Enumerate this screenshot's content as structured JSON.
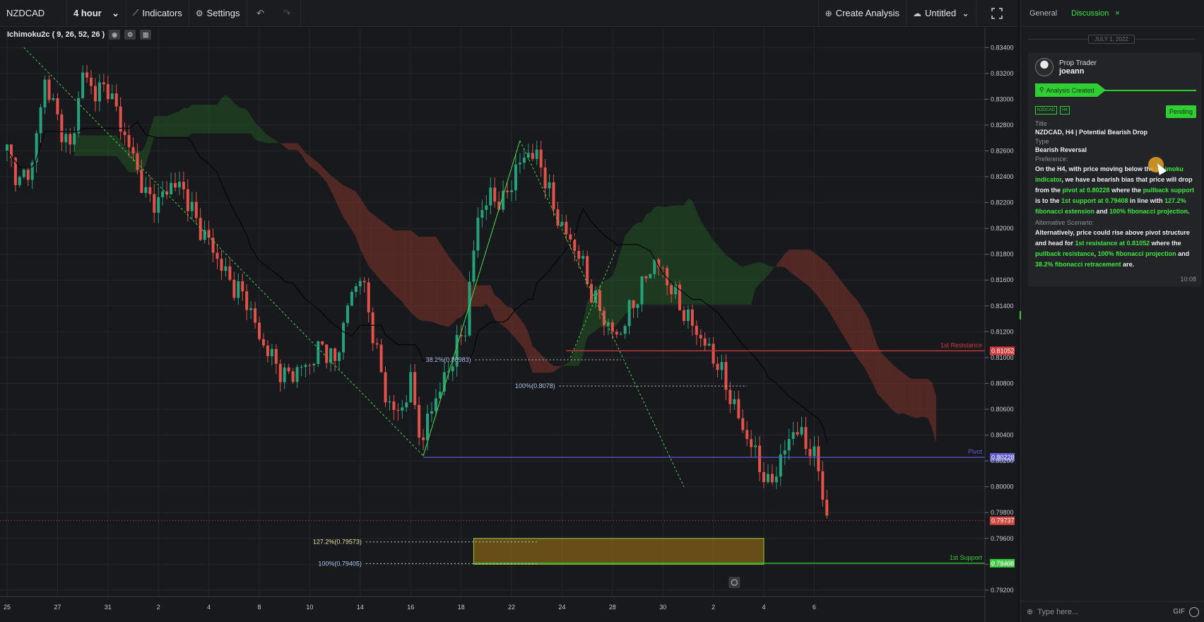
{
  "toolbar": {
    "symbol": "NZDCAD",
    "interval": "4 hour",
    "indicators_label": "Indicators",
    "settings_label": "Settings",
    "undo_icon": "undo-icon",
    "redo_icon": "redo-icon",
    "create_analysis_label": "Create Analysis",
    "layout_name": "Untitled",
    "fullscreen_icon": "fullscreen-icon"
  },
  "indicator_legend": "Ichimoku2c ( 9, 26, 52, 26 )",
  "chart_data": {
    "type": "candlestick",
    "symbol": "NZDCAD",
    "timeframe": "4 hour",
    "y_ticks": [
      "0.83400",
      "0.83200",
      "0.83000",
      "0.82800",
      "0.82600",
      "0.82400",
      "0.82200",
      "0.82000",
      "0.81800",
      "0.81600",
      "0.81400",
      "0.81200",
      "0.81000",
      "0.80800",
      "0.80600",
      "0.80400",
      "0.80200",
      "0.80000",
      "0.79800",
      "0.79600",
      "0.79400",
      "0.79200"
    ],
    "y_tick_values": [
      0.834,
      0.832,
      0.83,
      0.828,
      0.826,
      0.824,
      0.822,
      0.82,
      0.818,
      0.816,
      0.814,
      0.812,
      0.81,
      0.808,
      0.806,
      0.804,
      0.802,
      0.8,
      0.798,
      0.796,
      0.794,
      0.792
    ],
    "x_ticks": [
      "25",
      "27",
      "31",
      "2",
      "4",
      "8",
      "10",
      "14",
      "16",
      "18",
      "22",
      "24",
      "28",
      "30",
      "2",
      "4",
      "6"
    ],
    "x_tick_bars": [
      0,
      12,
      24,
      36,
      48,
      60,
      72,
      84,
      96,
      108,
      120,
      132,
      144,
      156,
      168,
      180,
      192
    ],
    "price_path": [
      [
        0,
        0.826
      ],
      [
        3,
        0.8235
      ],
      [
        6,
        0.825
      ],
      [
        9,
        0.8315
      ],
      [
        12,
        0.8285
      ],
      [
        15,
        0.826
      ],
      [
        18,
        0.832
      ],
      [
        21,
        0.8305
      ],
      [
        24,
        0.831
      ],
      [
        27,
        0.828
      ],
      [
        30,
        0.8255
      ],
      [
        33,
        0.8225
      ],
      [
        36,
        0.822
      ],
      [
        39,
        0.8235
      ],
      [
        42,
        0.823
      ],
      [
        45,
        0.8205
      ],
      [
        48,
        0.819
      ],
      [
        51,
        0.817
      ],
      [
        54,
        0.8155
      ],
      [
        57,
        0.8145
      ],
      [
        60,
        0.8115
      ],
      [
        63,
        0.81
      ],
      [
        66,
        0.8085
      ],
      [
        69,
        0.809
      ],
      [
        72,
        0.8095
      ],
      [
        75,
        0.811
      ],
      [
        78,
        0.8095
      ],
      [
        81,
        0.814
      ],
      [
        84,
        0.8165
      ],
      [
        87,
        0.812
      ],
      [
        90,
        0.807
      ],
      [
        93,
        0.8055
      ],
      [
        96,
        0.808
      ],
      [
        99,
        0.803
      ],
      [
        100,
        0.8055
      ],
      [
        103,
        0.8075
      ],
      [
        106,
        0.81
      ],
      [
        109,
        0.8125
      ],
      [
        112,
        0.821
      ],
      [
        115,
        0.8225
      ],
      [
        118,
        0.822
      ],
      [
        121,
        0.8245
      ],
      [
        124,
        0.826
      ],
      [
        127,
        0.825
      ],
      [
        130,
        0.8215
      ],
      [
        133,
        0.8195
      ],
      [
        136,
        0.818
      ],
      [
        139,
        0.815
      ],
      [
        142,
        0.813
      ],
      [
        145,
        0.8115
      ],
      [
        148,
        0.8135
      ],
      [
        151,
        0.8155
      ],
      [
        154,
        0.8175
      ],
      [
        157,
        0.816
      ],
      [
        160,
        0.814
      ],
      [
        163,
        0.8125
      ],
      [
        166,
        0.811
      ],
      [
        169,
        0.8095
      ],
      [
        172,
        0.807
      ],
      [
        175,
        0.8045
      ],
      [
        178,
        0.8025
      ],
      [
        181,
        0.8
      ],
      [
        184,
        0.802
      ],
      [
        187,
        0.8045
      ],
      [
        190,
        0.8035
      ],
      [
        193,
        0.8015
      ],
      [
        195,
        0.7974
      ]
    ],
    "bar_x0": 10,
    "bar_dx": 5.95,
    "ymin": 0.7915,
    "ymax": 0.835,
    "last_price": "0.79737",
    "last_price_value": 0.79737,
    "levels": [
      {
        "name": "1st Resistance",
        "value": 0.81052,
        "label": "0.81052",
        "color": "#d63a3a"
      },
      {
        "name": "Pivot",
        "value": 0.80228,
        "label": "0.80228",
        "color": "#5b5bd6"
      },
      {
        "name": "1st Support",
        "value": 0.79408,
        "label": "0.79408",
        "color": "#2fcf34"
      }
    ],
    "fib_labels": [
      {
        "text": "38.2%(0.80983)",
        "value": 0.80983
      },
      {
        "text": "100%(0.8078)",
        "value": 0.8078
      },
      {
        "text": "127.2%(0.79573)",
        "value": 0.79573
      },
      {
        "text": "100%(0.79405)",
        "value": 0.79405
      }
    ],
    "target_zone": {
      "top": 0.796,
      "bottom": 0.794
    },
    "grid": true
  },
  "panel": {
    "tabs": [
      "General",
      "Discussion"
    ],
    "close_icon": "close-icon",
    "date_separator": "JULY 1, 2022",
    "card": {
      "role": "Prop Trader",
      "username": "joeann",
      "analysis_created": "Analysis Created",
      "tags": [
        "NZDCAD",
        "H4"
      ],
      "status": "Pending",
      "title_label": "Title",
      "title_value": "NZDCAD, H4 | Potential Bearish Drop",
      "type_label": "Type",
      "type_value": "Bearish Reversal",
      "preference_label": "Preference:",
      "preference": {
        "p1": "On the H4, with price moving below the ",
        "h1": "ichimoku indicator",
        "p2": ", we have a bearish bias that price will drop from the ",
        "h2": "pivot at 0.80228",
        "p3": " where the ",
        "h3": "pullback support",
        "p4": " is to the ",
        "h4": "1st support at 0.79408",
        "p5": " in line with ",
        "h5": "127.2% fibonacci extension",
        "p6": " and ",
        "h6": "100% fibonacci projection",
        "p7": "."
      },
      "alt_label": "Alternative Scenario:",
      "alt": {
        "p1": "Alternatively, price could rise above pivot structure and head for ",
        "h1": "1st resistance at 0.81052",
        "p2": " where the ",
        "h2": "pullback resistance",
        "p3": ", ",
        "h3": "100% fibonacci projection",
        "p4": " and ",
        "h4": "38.2% fibonacci retracement",
        "p5": " are."
      },
      "time": "10:08"
    },
    "message_placeholder": "Type here...",
    "gif_label": "GIF"
  }
}
